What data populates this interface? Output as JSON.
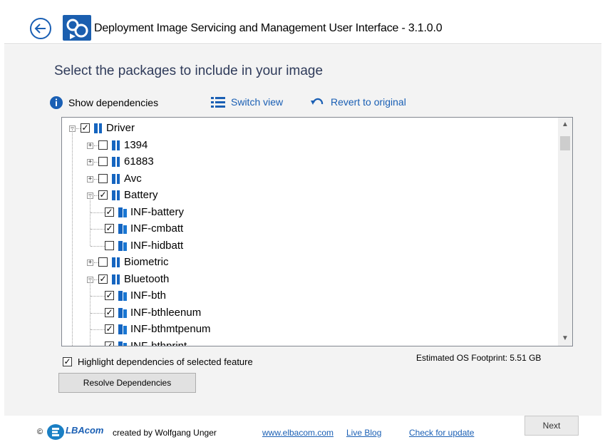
{
  "window": {
    "title": "Deployment Image Servicing and Management User Interface - 3.1.0.0"
  },
  "page": {
    "heading": "Select the packages to include in your image"
  },
  "toolbar": {
    "show_dependencies": "Show dependencies",
    "switch_view": "Switch view",
    "revert": "Revert to original"
  },
  "tree": {
    "rows": [
      {
        "label": "Driver",
        "checked": true,
        "expand": "minus",
        "level": 0,
        "icon": "folder"
      },
      {
        "label": "1394",
        "checked": false,
        "expand": "plus",
        "level": 1,
        "icon": "folder"
      },
      {
        "label": "61883",
        "checked": false,
        "expand": "plus",
        "level": 1,
        "icon": "folder"
      },
      {
        "label": "Avc",
        "checked": false,
        "expand": "plus",
        "level": 1,
        "icon": "folder"
      },
      {
        "label": "Battery",
        "checked": true,
        "expand": "minus",
        "level": 1,
        "icon": "folder"
      },
      {
        "label": "INF-battery",
        "checked": true,
        "expand": "none",
        "level": 2,
        "icon": "package"
      },
      {
        "label": "INF-cmbatt",
        "checked": true,
        "expand": "none",
        "level": 2,
        "icon": "package"
      },
      {
        "label": "INF-hidbatt",
        "checked": false,
        "expand": "none",
        "level": 2,
        "icon": "package"
      },
      {
        "label": "Biometric",
        "checked": false,
        "expand": "plus",
        "level": 1,
        "icon": "folder"
      },
      {
        "label": "Bluetooth",
        "checked": true,
        "expand": "minus",
        "level": 1,
        "icon": "folder"
      },
      {
        "label": "INF-bth",
        "checked": true,
        "expand": "none",
        "level": 2,
        "icon": "package"
      },
      {
        "label": "INF-bthleenum",
        "checked": true,
        "expand": "none",
        "level": 2,
        "icon": "package"
      },
      {
        "label": "INF-bthmtpenum",
        "checked": true,
        "expand": "none",
        "level": 2,
        "icon": "package"
      },
      {
        "label": "INF-bthprint",
        "checked": true,
        "expand": "none",
        "level": 2,
        "icon": "package"
      }
    ]
  },
  "options": {
    "highlight_label": "Highlight dependencies of selected feature",
    "highlight_checked": true,
    "footprint": "Estimated OS Footprint: 5.51 GB",
    "resolve_button": "Resolve Dependencies"
  },
  "footer": {
    "copyright": "©",
    "brand": "LBAcom",
    "author": "created by Wolfgang Unger",
    "links": [
      "www.elbacom.com",
      "Live Blog",
      "Check for update"
    ],
    "next_button": "Next"
  },
  "colors": {
    "accent": "#1a5fb4",
    "tree_icon": "#1565c0",
    "content_bg": "#f3f3f3"
  }
}
